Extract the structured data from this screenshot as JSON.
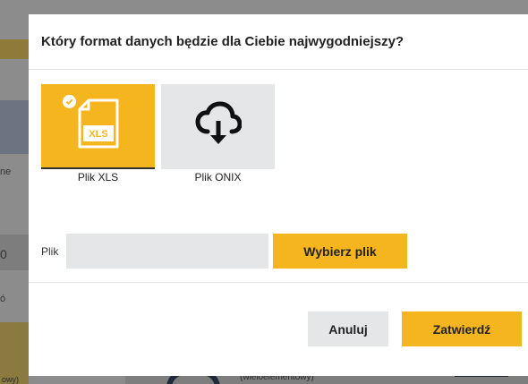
{
  "background": {
    "partial_text": "(wieloelementowy)",
    "partial_text_left": "owy)",
    "edge_chars": [
      "ne",
      "0",
      "ó"
    ]
  },
  "modal": {
    "title": "Który format danych będzie dla Ciebie najwygodniejszy?",
    "formats": [
      {
        "label": "Plik XLS",
        "icon": "xls-file-icon",
        "badge": "XLS",
        "selected": true
      },
      {
        "label": "Plik ONIX",
        "icon": "cloud-download-icon",
        "selected": false
      }
    ],
    "file": {
      "label": "Plik",
      "value": "",
      "choose_label": "Wybierz plik"
    },
    "actions": {
      "cancel_label": "Anuluj",
      "confirm_label": "Zatwierdź"
    }
  },
  "colors": {
    "accent": "#f5b51e",
    "tile_inactive": "#e4e6e8",
    "text": "#222222"
  }
}
